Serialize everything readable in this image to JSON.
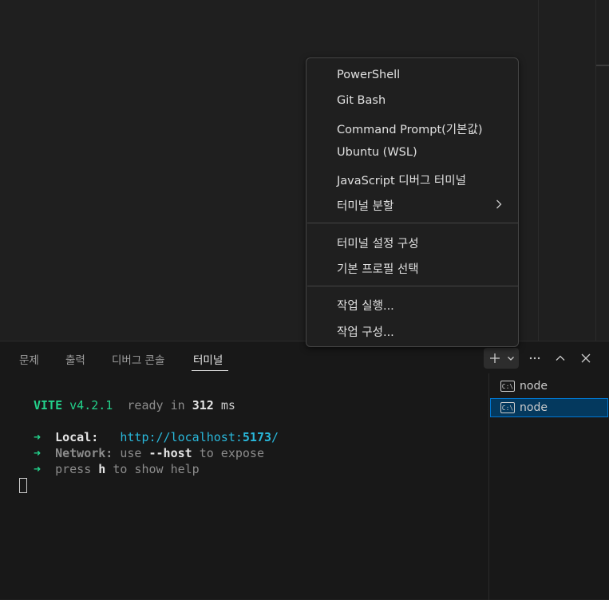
{
  "panel": {
    "tabs": [
      "문제",
      "출력",
      "디버그 콘솔",
      "터미널"
    ],
    "active_tab": "터미널"
  },
  "toolbar": {
    "new_terminal_icon": "plus-icon",
    "dropdown_icon": "chevron-down-icon",
    "more_icon": "ellipsis-icon",
    "maximize_icon": "chevron-up-icon",
    "close_icon": "close-icon"
  },
  "terminal": {
    "vite_name": "VITE",
    "vite_version": "v4.2.1",
    "ready_text": "ready in",
    "ready_ms": "312",
    "ms_unit": "ms",
    "arrow": "➜",
    "local_label": "Local:",
    "local_url_prefix": "http://localhost:",
    "local_url_port": "5173",
    "local_url_suffix": "/",
    "network_label": "Network:",
    "network_use": "use",
    "network_flag": "--host",
    "network_rest": "to expose",
    "help_press": "press",
    "help_key": "h",
    "help_rest": "to show help"
  },
  "terminal_list": [
    {
      "label": "node",
      "selected": false
    },
    {
      "label": "node",
      "selected": true
    }
  ],
  "menu": {
    "group1": [
      "PowerShell",
      "Git Bash",
      "Command Prompt(기본값)",
      "Ubuntu (WSL)",
      "JavaScript 디버그 터미널",
      "터미널 분할"
    ],
    "group2": [
      "터미널 설정 구성",
      "기본 프로필 선택"
    ],
    "group3": [
      "작업 실행...",
      "작업 구성..."
    ]
  },
  "colors": {
    "accent": "#0078d4",
    "green": "#23d18b",
    "url": "#29b8db",
    "background": "#1f1f1f"
  }
}
